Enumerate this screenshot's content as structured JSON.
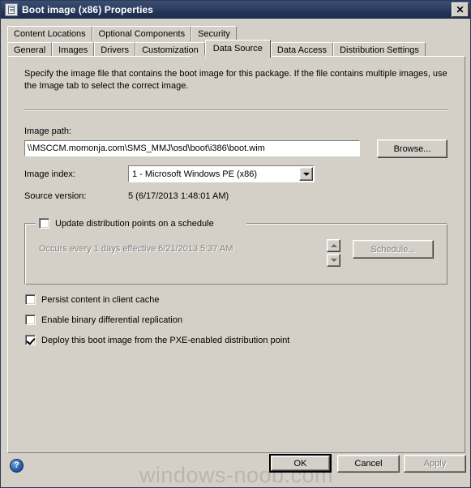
{
  "window": {
    "title": "Boot image (x86) Properties",
    "icon": "document-properties-icon",
    "close_label": "✕"
  },
  "tabs": {
    "row1": [
      {
        "label": "Content Locations",
        "selected": false
      },
      {
        "label": "Optional Components",
        "selected": false
      },
      {
        "label": "Security",
        "selected": false
      }
    ],
    "row2": [
      {
        "label": "General",
        "selected": false
      },
      {
        "label": "Images",
        "selected": false
      },
      {
        "label": "Drivers",
        "selected": false
      },
      {
        "label": "Customization",
        "selected": false
      },
      {
        "label": "Data Source",
        "selected": true
      },
      {
        "label": "Data Access",
        "selected": false
      },
      {
        "label": "Distribution Settings",
        "selected": false
      }
    ]
  },
  "panel": {
    "instructions": "Specify the image file that contains the boot image for this package. If the file contains multiple images, use the Image tab to select the correct image.",
    "image_path": {
      "label": "Image path:",
      "value": "\\\\MSCCM.momonja.com\\SMS_MMJ\\osd\\boot\\i386\\boot.wim",
      "browse_label": "Browse..."
    },
    "image_index": {
      "label": "Image index:",
      "value": "1 - Microsoft Windows PE (x86)"
    },
    "source_version": {
      "label": "Source version:",
      "value": "5 (6/17/2013 1:48:01 AM)"
    },
    "schedule_group": {
      "checkbox_label": "Update distribution points on a schedule",
      "checked": false,
      "enabled": false,
      "schedule_text": "Occurs every 1 days effective 6/21/2013 5:37 AM",
      "schedule_button": "Schedule..."
    },
    "options": [
      {
        "label": "Persist content in client cache",
        "checked": false
      },
      {
        "label": "Enable binary differential replication",
        "checked": false
      },
      {
        "label": "Deploy this boot image from the PXE-enabled distribution point",
        "checked": true
      }
    ]
  },
  "footer": {
    "help_glyph": "?",
    "ok_label": "OK",
    "cancel_label": "Cancel",
    "apply_label": "Apply",
    "apply_disabled": true,
    "watermark": "windows-noob.com"
  },
  "colors": {
    "window_face": "#d4d0c8",
    "titlebar_start": "#3b4f72",
    "titlebar_end": "#1d2d4f",
    "title_text": "#ffffff",
    "disabled_text": "#808080",
    "watermark": "#b9b6ae"
  }
}
